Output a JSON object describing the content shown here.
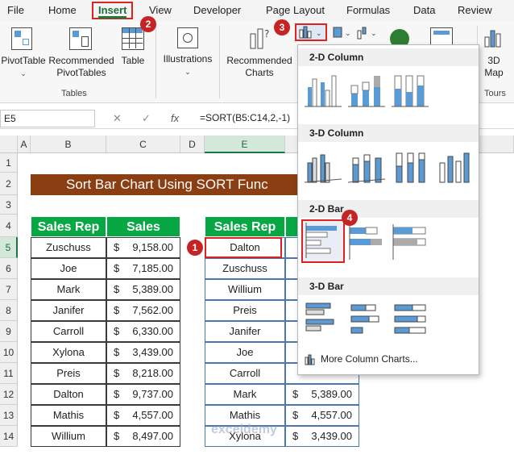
{
  "ribbon_tabs": [
    "File",
    "Home",
    "Insert",
    "View",
    "Developer",
    "Page Layout",
    "Formulas",
    "Data",
    "Review"
  ],
  "ribbon": {
    "pivottable": "PivotTable",
    "recommended_pivottables_l1": "Recommended",
    "recommended_pivottables_l2": "PivotTables",
    "table": "Table",
    "tables_group": "Tables",
    "illustrations": "Illustrations",
    "recommended_charts_l1": "Recommended",
    "recommended_charts_l2": "Charts",
    "map_l1": "3D",
    "map_l2": "Map",
    "tours_group": "Tours"
  },
  "formula_bar": {
    "name_box": "E5",
    "formula": "=SORT(B5:C14,2,-1)"
  },
  "columns": [
    "A",
    "B",
    "C",
    "D",
    "E"
  ],
  "rows": [
    "1",
    "2",
    "3",
    "4",
    "5",
    "6",
    "7",
    "8",
    "9",
    "10",
    "11",
    "12",
    "13",
    "14"
  ],
  "sheet": {
    "title": "Sort Bar Chart Using SORT Func",
    "headers": {
      "rep": "Sales Rep",
      "sales": "Sales"
    },
    "currency": "$",
    "source": [
      {
        "name": "Zuschuss",
        "amount": "9,158.00"
      },
      {
        "name": "Joe",
        "amount": "7,185.00"
      },
      {
        "name": "Mark",
        "amount": "5,389.00"
      },
      {
        "name": "Janifer",
        "amount": "7,562.00"
      },
      {
        "name": "Carroll",
        "amount": "6,330.00"
      },
      {
        "name": "Xylona",
        "amount": "3,439.00"
      },
      {
        "name": "Preis",
        "amount": "8,218.00"
      },
      {
        "name": "Dalton",
        "amount": "9,737.00"
      },
      {
        "name": "Mathis",
        "amount": "4,557.00"
      },
      {
        "name": "Willium",
        "amount": "8,497.00"
      }
    ],
    "sorted": [
      {
        "name": "Dalton",
        "amount": ""
      },
      {
        "name": "Zuschuss",
        "amount": ""
      },
      {
        "name": "Willium",
        "amount": ""
      },
      {
        "name": "Preis",
        "amount": ""
      },
      {
        "name": "Janifer",
        "amount": ""
      },
      {
        "name": "Joe",
        "amount": ""
      },
      {
        "name": "Carroll",
        "amount": ""
      },
      {
        "name": "Mark",
        "amount": "5,389.00"
      },
      {
        "name": "Mathis",
        "amount": "4,557.00"
      },
      {
        "name": "Xylona",
        "amount": "3,439.00"
      }
    ]
  },
  "gallery": {
    "col2d": "2-D Column",
    "col3d": "3-D Column",
    "bar2d": "2-D Bar",
    "bar3d": "3-D Bar",
    "more": "More Column Charts..."
  },
  "badges": [
    "1",
    "2",
    "3",
    "4"
  ],
  "watermark": "exceldemy",
  "colors": {
    "accent_green": "#07a844",
    "banner": "#8b3e12",
    "badge": "#c62424",
    "chart_blue": "#5b9bd5"
  }
}
